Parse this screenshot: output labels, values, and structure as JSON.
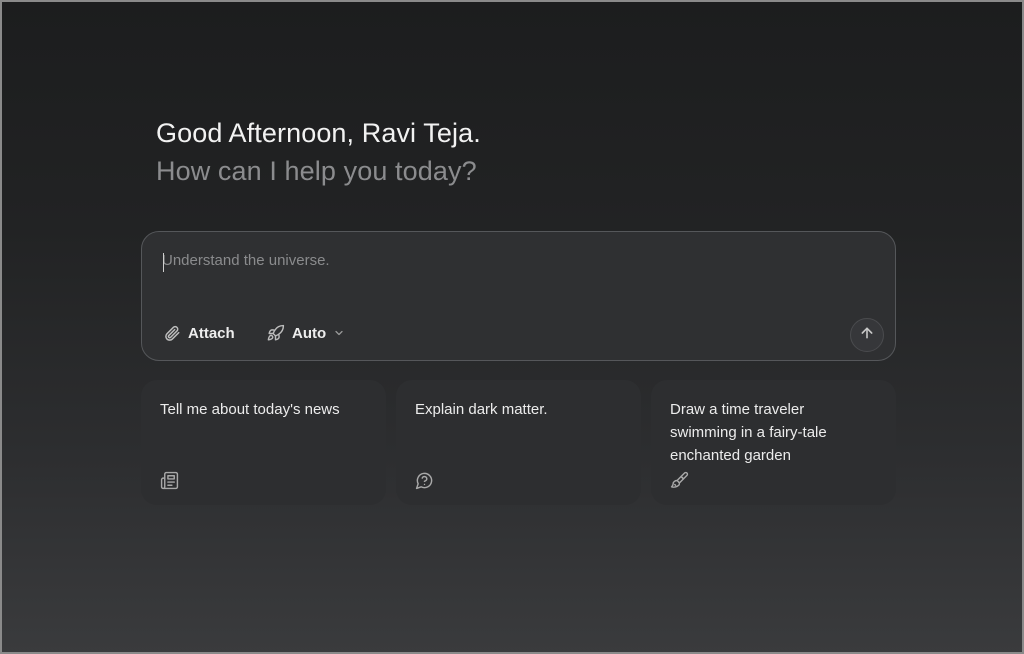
{
  "greeting": "Good Afternoon, Ravi Teja.",
  "subgreeting": "How can I help you today?",
  "composer": {
    "placeholder": "Understand the universe.",
    "value": "",
    "attach_label": "Attach",
    "mode_label": "Auto",
    "icons": [
      "paperclip-icon",
      "rocket-icon",
      "chevron-down-icon",
      "arrow-up-icon"
    ]
  },
  "suggestions": [
    {
      "label": "Tell me about today's news",
      "icon": "newspaper-icon"
    },
    {
      "label": "Explain dark matter.",
      "icon": "question-bubble-icon"
    },
    {
      "label": "Draw a time traveler swimming in a fairy-tale enchanted garden",
      "icon": "paintbrush-icon"
    }
  ]
}
